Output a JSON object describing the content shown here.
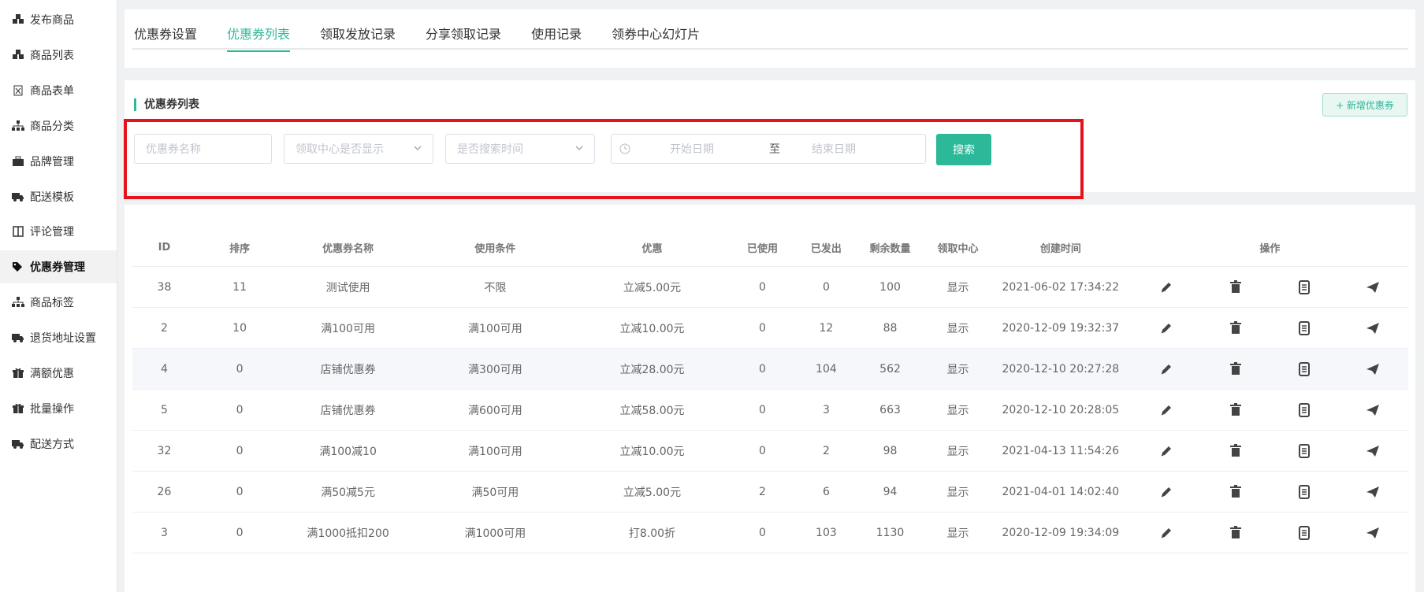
{
  "sidebar": {
    "items": [
      {
        "label": "发布商品",
        "icon": "cubes-icon"
      },
      {
        "label": "商品列表",
        "icon": "cubes-icon"
      },
      {
        "label": "商品表单",
        "icon": "file-excel-icon"
      },
      {
        "label": "商品分类",
        "icon": "sitemap-icon"
      },
      {
        "label": "品牌管理",
        "icon": "briefcase-icon"
      },
      {
        "label": "配送模板",
        "icon": "truck-icon"
      },
      {
        "label": "评论管理",
        "icon": "columns-icon"
      },
      {
        "label": "优惠券管理",
        "icon": "tags-icon",
        "active": true
      },
      {
        "label": "商品标签",
        "icon": "sitemap-icon"
      },
      {
        "label": "退货地址设置",
        "icon": "truck-icon"
      },
      {
        "label": "满额优惠",
        "icon": "gift-icon"
      },
      {
        "label": "批量操作",
        "icon": "gift-icon"
      },
      {
        "label": "配送方式",
        "icon": "truck-icon"
      }
    ]
  },
  "tabs": [
    {
      "label": "优惠券设置"
    },
    {
      "label": "优惠券列表",
      "active": true
    },
    {
      "label": "领取发放记录"
    },
    {
      "label": "分享领取记录"
    },
    {
      "label": "使用记录"
    },
    {
      "label": "领券中心幻灯片"
    }
  ],
  "section_title": "优惠券列表",
  "add_button": "+ 新增优惠券",
  "filters": {
    "name_placeholder": "优惠券名称",
    "center_placeholder": "领取中心是否显示",
    "time_placeholder": "是否搜索时间",
    "start_placeholder": "开始日期",
    "range_sep": "至",
    "end_placeholder": "结束日期",
    "search_label": "搜索"
  },
  "table": {
    "headers": [
      "ID",
      "排序",
      "优惠券名称",
      "使用条件",
      "优惠",
      "已使用",
      "已发出",
      "剩余数量",
      "领取中心",
      "创建时间",
      "操作"
    ],
    "rows": [
      [
        "38",
        "11",
        "测试使用",
        "不限",
        "立减5.00元",
        "0",
        "0",
        "100",
        "显示",
        "2021-06-02 17:34:22"
      ],
      [
        "2",
        "10",
        "满100可用",
        "满100可用",
        "立减10.00元",
        "0",
        "12",
        "88",
        "显示",
        "2020-12-09 19:32:37"
      ],
      [
        "4",
        "0",
        "店铺优惠券",
        "满300可用",
        "立减28.00元",
        "0",
        "104",
        "562",
        "显示",
        "2020-12-10 20:27:28"
      ],
      [
        "5",
        "0",
        "店铺优惠券",
        "满600可用",
        "立减58.00元",
        "0",
        "3",
        "663",
        "显示",
        "2020-12-10 20:28:05"
      ],
      [
        "32",
        "0",
        "满100减10",
        "满100可用",
        "立减10.00元",
        "0",
        "2",
        "98",
        "显示",
        "2021-04-13 11:54:26"
      ],
      [
        "26",
        "0",
        "满50减5元",
        "满50可用",
        "立减5.00元",
        "2",
        "6",
        "94",
        "显示",
        "2021-04-01 14:02:40"
      ],
      [
        "3",
        "0",
        "满1000抵扣200",
        "满1000可用",
        "打8.00折",
        "0",
        "103",
        "1130",
        "显示",
        "2020-12-09 19:34:09"
      ]
    ],
    "highlighted_row": 2
  },
  "colors": {
    "accent": "#2cb999",
    "highlight_box": "#e5141c"
  }
}
